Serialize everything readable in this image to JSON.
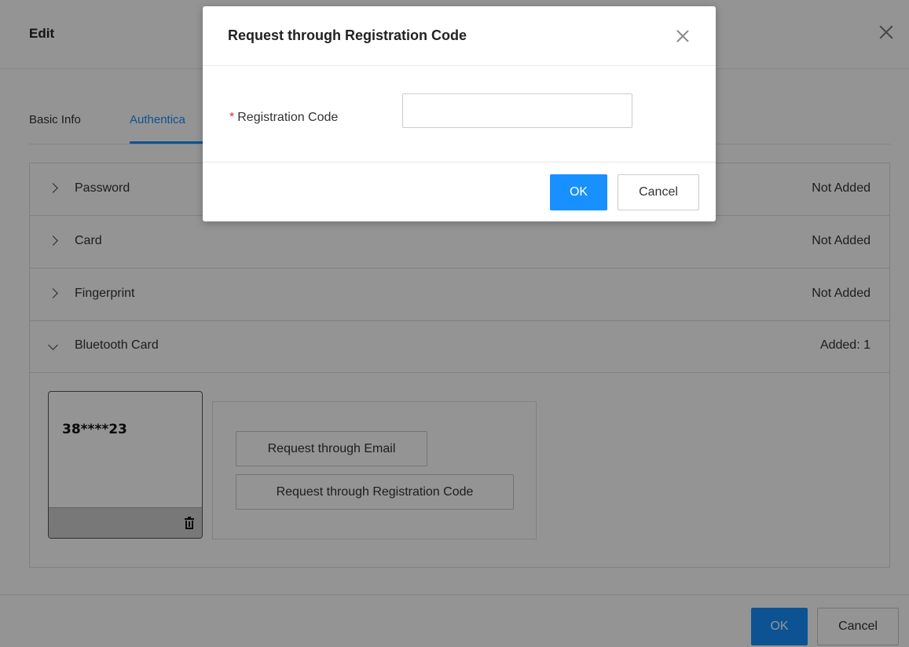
{
  "edit_dialog": {
    "title": "Edit",
    "tabs": [
      {
        "label": "Basic Info"
      },
      {
        "label": "Authentica"
      }
    ],
    "sections": [
      {
        "label": "Password",
        "status": "Not Added",
        "expanded": false
      },
      {
        "label": "Card",
        "status": "Not Added",
        "expanded": false
      },
      {
        "label": "Fingerprint",
        "status": "Not Added",
        "expanded": false
      },
      {
        "label": "Bluetooth Card",
        "status": "Added: 1",
        "expanded": true
      }
    ],
    "bluetooth_card": {
      "number": "38****23",
      "request_email_label": "Request through Email",
      "request_code_label": "Request through Registration Code"
    },
    "footer": {
      "ok_label": "OK",
      "cancel_label": "Cancel"
    }
  },
  "modal": {
    "title": "Request through Registration Code",
    "field_label": "Registration Code",
    "required_mark": "*",
    "field_value": "",
    "ok_label": "OK",
    "cancel_label": "Cancel"
  },
  "colors": {
    "accent": "#1890ff",
    "required": "#f5222d",
    "overlay": "rgba(0,0,0,0.42)"
  }
}
